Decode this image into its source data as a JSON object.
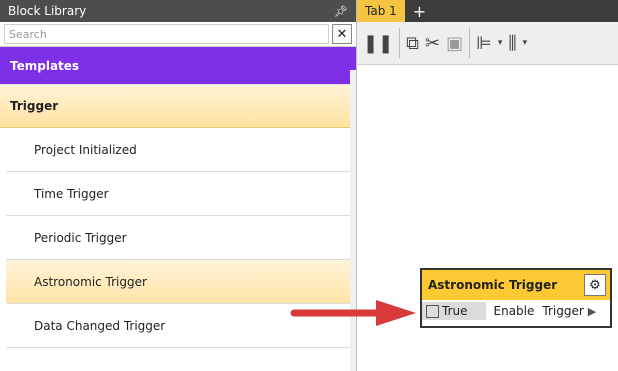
{
  "library": {
    "title": "Block Library",
    "search_placeholder": "Search",
    "categories": [
      {
        "label": "Templates"
      },
      {
        "label": "Trigger"
      }
    ],
    "items": [
      {
        "label": "Project Initialized"
      },
      {
        "label": "Time Trigger"
      },
      {
        "label": "Periodic Trigger"
      },
      {
        "label": "Astronomic Trigger"
      },
      {
        "label": "Data Changed Trigger"
      }
    ]
  },
  "tabs": [
    {
      "label": "Tab 1"
    }
  ],
  "block": {
    "title": "Astronomic Trigger",
    "value": "True",
    "input_label": "Enable",
    "output_label": "Trigger"
  },
  "colors": {
    "templates_bg": "#7e2fe8",
    "trigger_bg": "#ffe2a0",
    "block_header": "#ffc933",
    "arrow": "#d83a3a",
    "tab_active": "#f5c542"
  }
}
